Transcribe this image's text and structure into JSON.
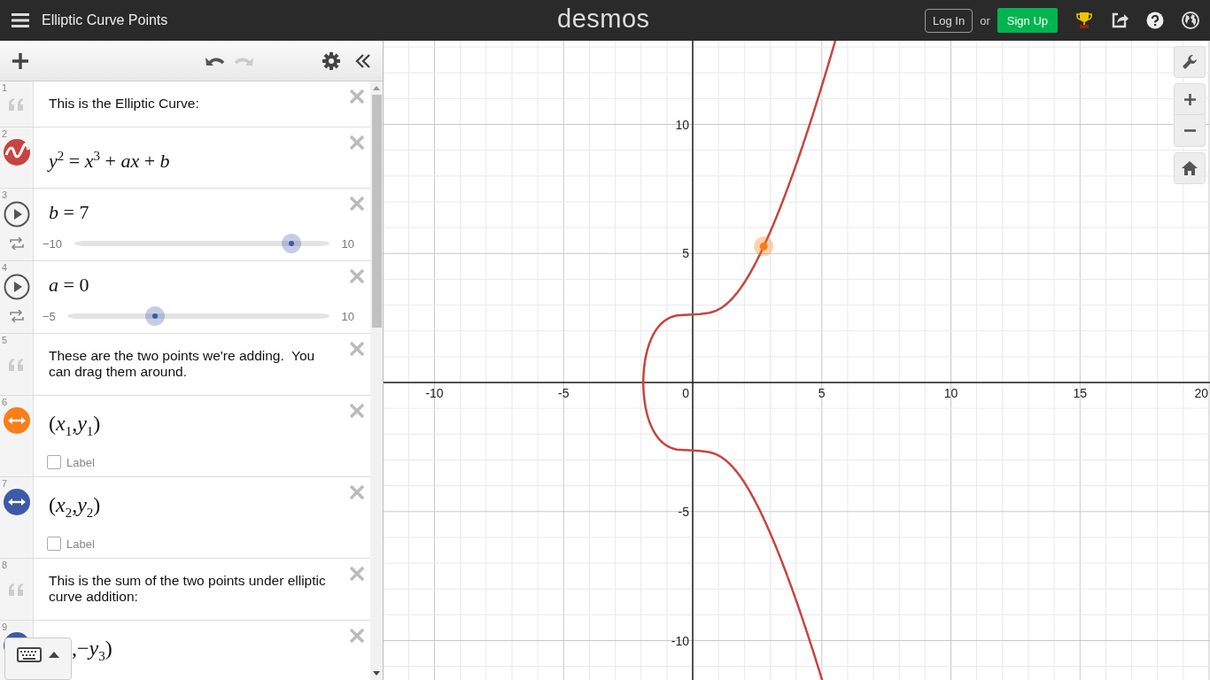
{
  "header": {
    "title": "Elliptic Curve Points",
    "logo": "desmos",
    "login": "Log In",
    "or": "or",
    "signup": "Sign Up"
  },
  "toolbar": {
    "undo": {
      "disabled": false
    },
    "redo": {
      "disabled": true
    }
  },
  "expressions": [
    {
      "kind": "note",
      "number": "1",
      "text": "This is the Elliptic Curve:"
    },
    {
      "kind": "expression",
      "number": "2",
      "math": "*y*$^{2}$ = *x*$^{3}$ + *ax* + *b*",
      "color": "#c74440"
    },
    {
      "kind": "slider",
      "number": "3",
      "math": "*b* = 7",
      "min": "−10",
      "max": "10",
      "level": 0.85
    },
    {
      "kind": "slider",
      "number": "4",
      "math": "*a* = 0",
      "min": "−5",
      "max": "10",
      "level": 0.333
    },
    {
      "kind": "note",
      "number": "5",
      "text": "These are the two points we're adding.  You can drag them around."
    },
    {
      "kind": "point",
      "number": "6",
      "math": "(*x*$_{1}$,*y*$_{1}$)",
      "color": "#fa7e19",
      "label": "Label",
      "checked": false
    },
    {
      "kind": "point",
      "number": "7",
      "math": "(*x*$_{2}$,*y*$_{2}$)",
      "color": "#3d5aa8",
      "label": "Label",
      "checked": false
    },
    {
      "kind": "note",
      "number": "8",
      "text": "This is the sum of the two points under elliptic curve addition:"
    },
    {
      "kind": "partial",
      "number": "9",
      "math": ",−*y*$_{3}$)",
      "color": "#3d5aa8"
    }
  ],
  "graph": {
    "x_tick_labels": [
      "-10",
      "-5",
      "0",
      "5",
      "10",
      "15",
      "20"
    ],
    "y_tick_labels": [
      "10",
      "5",
      "-5",
      "-10"
    ]
  }
}
